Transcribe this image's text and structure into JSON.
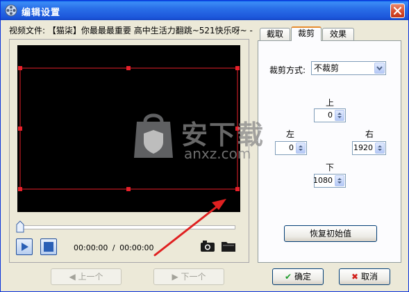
{
  "window": {
    "title": "编辑设置"
  },
  "file": {
    "label": "视频文件:",
    "name": "【猫柒】你最最最重要 高中生活力翻跳~521快乐呀~ -"
  },
  "player": {
    "time_current": "00:00:00",
    "time_separator": "/",
    "time_total": "00:00:00",
    "progress": 0
  },
  "tabs": [
    {
      "label": "截取",
      "active": false
    },
    {
      "label": "裁剪",
      "active": true
    },
    {
      "label": "效果",
      "active": false
    }
  ],
  "crop": {
    "mode_label": "裁剪方式:",
    "mode_value": "不裁剪",
    "top_label": "上",
    "top_value": "0",
    "left_label": "左",
    "left_value": "0",
    "right_label": "右",
    "right_value": "1920",
    "bottom_label": "下",
    "bottom_value": "1080",
    "reset_label": "恢复初始值"
  },
  "nav": {
    "prev_label": "上一个",
    "next_label": "下一个"
  },
  "actions": {
    "ok_label": "确定",
    "cancel_label": "取消"
  },
  "watermark": {
    "text": "安下载",
    "subtext": "anxz.com"
  },
  "colors": {
    "crop_frame": "#e8202a",
    "arrow": "#e02020",
    "titlebar": "#1c57db"
  }
}
